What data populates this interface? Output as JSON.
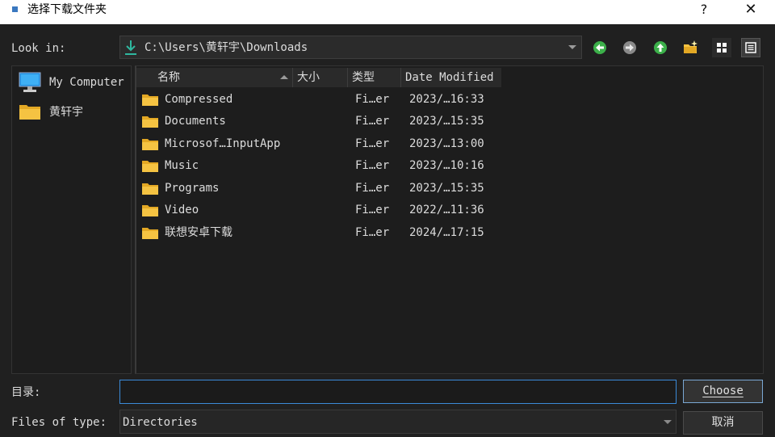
{
  "window": {
    "title": "选择下载文件夹",
    "help_glyph": "?",
    "close_glyph": "✕"
  },
  "lookin": {
    "label": "Look in:",
    "path": "C:\\Users\\黄轩宇\\Downloads"
  },
  "toolbar": {
    "buttons": [
      "back-icon",
      "forward-icon",
      "parent-folder-icon",
      "new-folder-icon",
      "icon-view-icon",
      "detail-view-icon"
    ]
  },
  "sidebar": {
    "items": [
      {
        "label": "My Computer",
        "icon": "computer-icon"
      },
      {
        "label": "黄轩宇",
        "icon": "folder-icon"
      }
    ]
  },
  "filelist": {
    "columns": [
      "名称",
      "大小",
      "类型",
      "Date Modified"
    ],
    "rows": [
      {
        "name": "Compressed",
        "type": "Fi…er",
        "date": "2023/…16:33"
      },
      {
        "name": "Documents",
        "type": "Fi…er",
        "date": "2023/…15:35"
      },
      {
        "name": "Microsof…InputApp",
        "type": "Fi…er",
        "date": "2023/…13:00"
      },
      {
        "name": "Music",
        "type": "Fi…er",
        "date": "2023/…10:16"
      },
      {
        "name": "Programs",
        "type": "Fi…er",
        "date": "2023/…15:35"
      },
      {
        "name": "Video",
        "type": "Fi…er",
        "date": "2022/…11:36"
      },
      {
        "name": "联想安卓下载",
        "type": "Fi…er",
        "date": "2024/…17:15"
      }
    ]
  },
  "bottom": {
    "dir_label": "目录:",
    "dir_value": "",
    "type_label": "Files of type:",
    "type_value": "Directories",
    "choose_label": "Choose",
    "cancel_label": "取消"
  },
  "colors": {
    "background": "#202020",
    "accent_focus": "#3b8ad8",
    "folder": "#f5c342",
    "nav_green": "#3cb04a"
  }
}
